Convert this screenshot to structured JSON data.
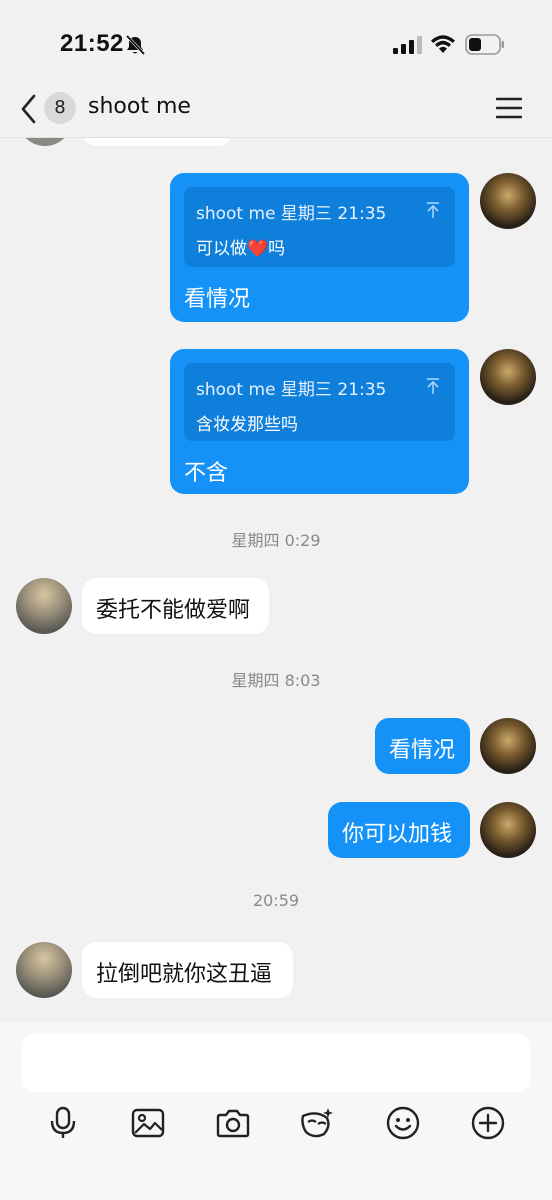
{
  "status_bar": {
    "time": "21:52"
  },
  "header": {
    "unread_count": "8",
    "title": "shoot me"
  },
  "messages": [
    {
      "type": "sent_quote",
      "quote_meta": "shoot me 星期三 21:35",
      "quote_text": "可以做❤️吗",
      "text": "看情况"
    },
    {
      "type": "sent_quote",
      "quote_meta": "shoot me 星期三 21:35",
      "quote_text": "含妆发那些吗",
      "text": "不含"
    },
    {
      "type": "timestamp",
      "text": "星期四 0:29"
    },
    {
      "type": "received",
      "text": "委托不能做爱啊"
    },
    {
      "type": "timestamp",
      "text": "星期四 8:03"
    },
    {
      "type": "sent",
      "text": "看情况"
    },
    {
      "type": "sent",
      "text": "你可以加钱"
    },
    {
      "type": "timestamp",
      "text": "20:59"
    },
    {
      "type": "received",
      "text": "拉倒吧就你这丑逼"
    }
  ],
  "input": {
    "placeholder": ""
  },
  "toolbar": [
    "microphone-icon",
    "image-icon",
    "camera-icon",
    "sticker-icon",
    "emoji-icon",
    "add-icon"
  ],
  "colors": {
    "sent_bubble": "#1592f7",
    "quote_box": "#0f7fdc",
    "received_bubble": "#ffffff",
    "background": "#f1f1f1"
  }
}
